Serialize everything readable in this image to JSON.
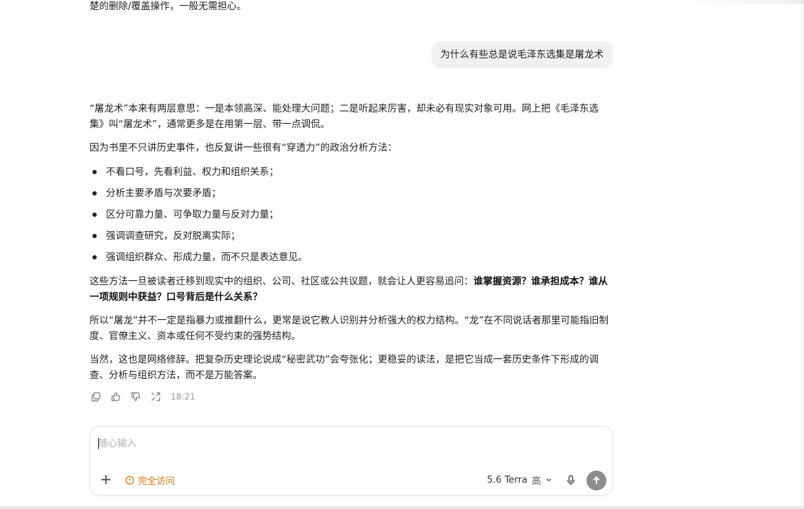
{
  "conversation": {
    "previous_tail": "楚的删除/覆盖操作，一般无需担心。",
    "user_message": "为什么有些总是说毛泽东选集是屠龙术",
    "answer": {
      "p1": "“屠龙术”本来有两层意思：一是本领高深、能处理大问题；二是听起来厉害，却未必有现实对象可用。网上把《毛泽东选集》叫“屠龙术”，通常更多是在用第一层、带一点调侃。",
      "p2": "因为书里不只讲历史事件，也反复讲一些很有“穿透力”的政治分析方法：",
      "bullets": [
        "不看口号，先看利益、权力和组织关系；",
        "分析主要矛盾与次要矛盾；",
        "区分可靠力量、可争取力量与反对力量；",
        "强调调查研究，反对脱离实际；",
        "强调组织群众、形成力量，而不只是表达意见。"
      ],
      "p3_plain": "这些方法一旦被读者迁移到现实中的组织、公司、社区或公共议题，就会让人更容易追问：",
      "p3_bold": "谁掌握资源？谁承担成本？谁从一项规则中获益？口号背后是什么关系？",
      "p4": "所以“屠龙”并不一定是指暴力或推翻什么，更常是说它教人识别并分析强大的权力结构。“龙”在不同说话者那里可能指旧制度、官僚主义、资本或任何不受约束的强势结构。",
      "p5": "当然，这也是网络修辞。把复杂历史理论说成“秘密武功”会夸张化；更稳妥的读法，是把它当成一套历史条件下形成的调查、分析与组织方法，而不是万能答案。"
    },
    "actions": {
      "icons": [
        "copy-icon",
        "thumbs-up-icon",
        "thumbs-down-icon",
        "share-icon"
      ],
      "time": "18:21"
    }
  },
  "composer": {
    "placeholder": "随心输入",
    "access_label": "完全访问",
    "model_name": "5.6 Terra",
    "effort": "高",
    "colors": {
      "access": "#d9730d",
      "send_button": "#8c8c8c"
    }
  }
}
